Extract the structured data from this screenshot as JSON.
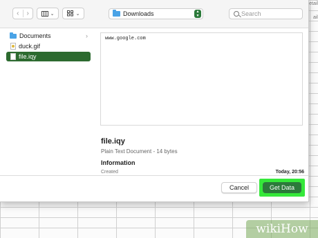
{
  "toolbar": {
    "back_glyph": "‹",
    "forward_glyph": "›",
    "view_icon": "columns-view-icon",
    "group_icon": "grid-view-icon",
    "chevron": "⌄",
    "location": "Downloads",
    "search_placeholder": "Search"
  },
  "sidebar": {
    "items": [
      {
        "label": "Documents",
        "icon": "folder-icon",
        "chevron": "›"
      },
      {
        "label": "duck.gif",
        "icon": "gif-file-icon"
      },
      {
        "label": "file.iqy",
        "icon": "document-icon",
        "selected": true
      }
    ]
  },
  "preview": {
    "content": "www.google.com"
  },
  "info": {
    "filename": "file.iqy",
    "type_line": "Plain Text Document - 14 bytes",
    "section": "Information",
    "created_label": "Created",
    "created_value": "Today, 20:56"
  },
  "buttons": {
    "cancel": "Cancel",
    "get_data": "Get Data"
  },
  "background": {
    "sheet_hint_1": "etail",
    "sheet_hint_2": "ail"
  },
  "watermark": {
    "text": "wikiHow"
  },
  "colors": {
    "accent_green": "#2c7a3b",
    "highlight_green": "#35e83a",
    "folder_blue": "#4aa3e6"
  }
}
